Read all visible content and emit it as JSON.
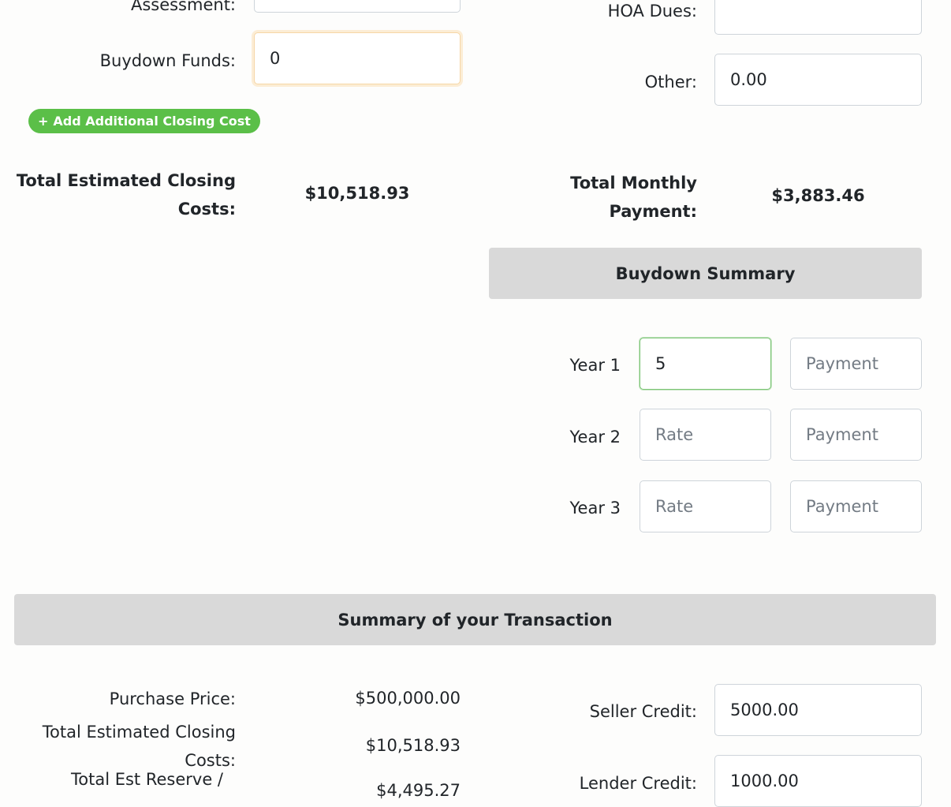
{
  "closing_costs": {
    "assessment_label": "Assessment:",
    "assessment_value": "",
    "buydown_funds_label": "Buydown Funds:",
    "buydown_funds_value": "0",
    "add_cost_button": "Add Additional Closing Cost",
    "add_cost_icon": "plus-icon",
    "total_label_line1": "Total Estimated Closing",
    "total_label_line2": "Costs:",
    "total_value": "$10,518.93"
  },
  "monthly": {
    "hoa_label": "HOA Dues:",
    "hoa_value": "",
    "other_label": "Other:",
    "other_value": "0.00",
    "total_label_line1": "Total Monthly",
    "total_label_line2": "Payment:",
    "total_value": "$3,883.46"
  },
  "buydown": {
    "title": "Buydown Summary",
    "rows": [
      {
        "label": "Year 1",
        "rate": "5",
        "rate_placeholder": "Rate",
        "payment": "",
        "payment_placeholder": "Payment"
      },
      {
        "label": "Year 2",
        "rate": "",
        "rate_placeholder": "Rate",
        "payment": "",
        "payment_placeholder": "Payment"
      },
      {
        "label": "Year 3",
        "rate": "",
        "rate_placeholder": "Rate",
        "payment": "",
        "payment_placeholder": "Payment"
      }
    ]
  },
  "summary": {
    "title": "Summary of your Transaction",
    "purchase_price_label": "Purchase Price:",
    "purchase_price_value": "$500,000.00",
    "closing_costs_label_line1": "Total Estimated Closing",
    "closing_costs_label_line2": "Costs:",
    "closing_costs_value": "$10,518.93",
    "reserve_label": "Total Est Reserve /",
    "reserve_value": "$4,495.27",
    "seller_credit_label": "Seller Credit:",
    "seller_credit_value": "5000.00",
    "lender_credit_label": "Lender Credit:",
    "lender_credit_value": "1000.00"
  },
  "colors": {
    "accent_green": "#5bbf48",
    "section_header_bg": "#d9d9d9",
    "page_bg": "#fdfdfc"
  }
}
